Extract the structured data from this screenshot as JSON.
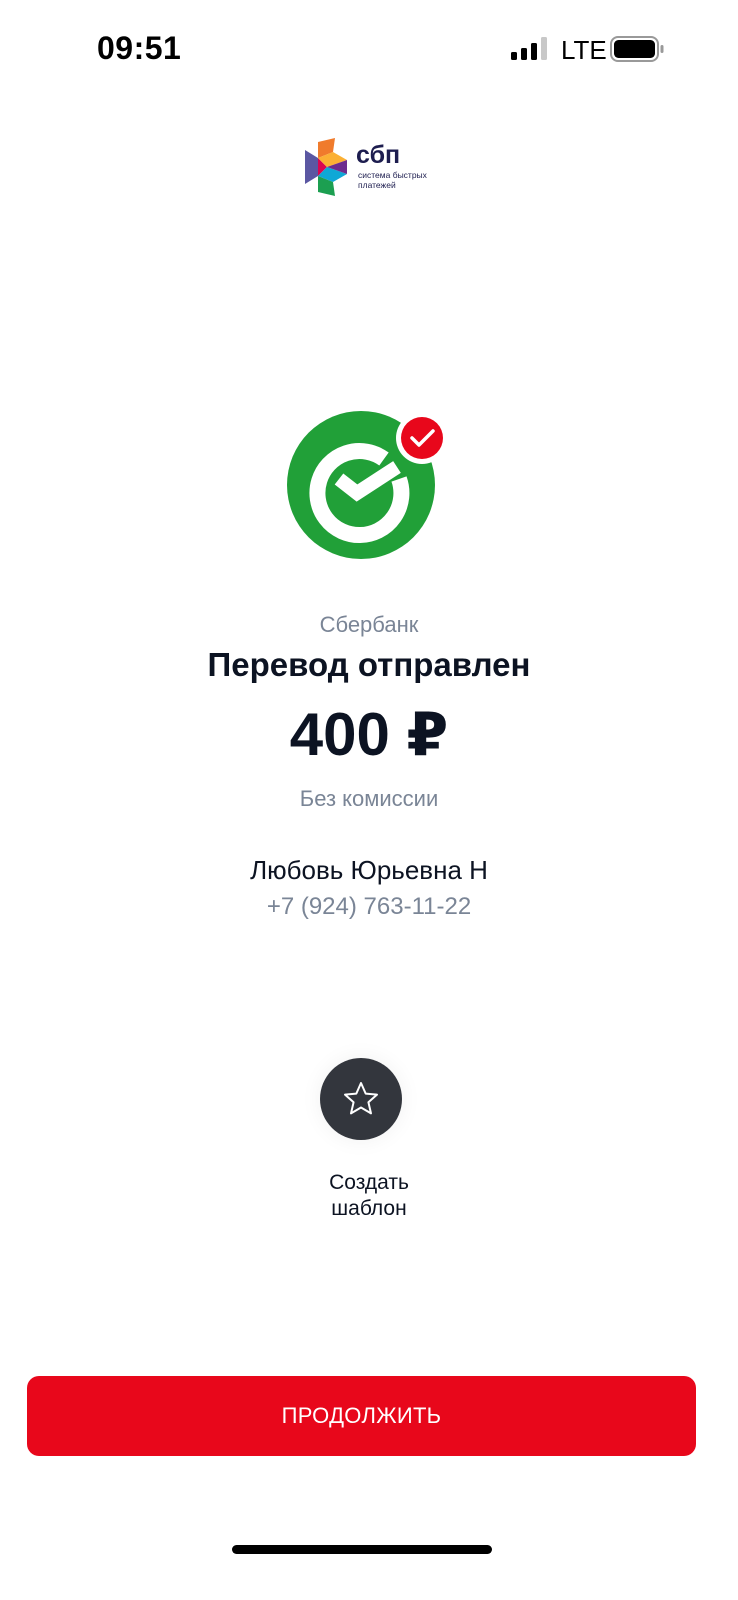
{
  "status_bar": {
    "time": "09:51",
    "network": "LTE"
  },
  "sbp_logo": {
    "title": "сбп",
    "subtitle": "система быстрых платежей"
  },
  "transfer": {
    "bank_name": "Сбербанк",
    "status_title": "Перевод отправлен",
    "amount": "400 ₽",
    "commission": "Без комиссии"
  },
  "recipient": {
    "name": "Любовь Юрьевна Н",
    "phone": "+7 (924) 763-11-22"
  },
  "template_action": {
    "label": "Создать шаблон",
    "icon": "star-icon"
  },
  "continue_button": {
    "label": "ПРОДОЛЖИТЬ"
  },
  "colors": {
    "accent": "#e8071b",
    "sber_green": "#21a038",
    "title_text": "#0c1322",
    "muted_text": "#7a8596",
    "template_button_bg": "#33363d"
  }
}
